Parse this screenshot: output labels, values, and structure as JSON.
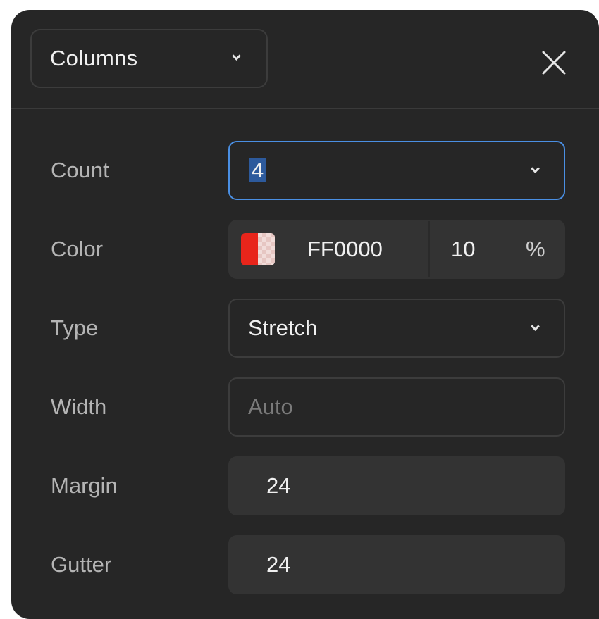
{
  "header": {
    "type_select_label": "Columns"
  },
  "rows": {
    "count": {
      "label": "Count",
      "value": "4"
    },
    "color": {
      "label": "Color",
      "hex": "FF0000",
      "opacity": "10",
      "opacity_unit": "%",
      "swatch_color": "#e8251b"
    },
    "type": {
      "label": "Type",
      "value": "Stretch"
    },
    "width": {
      "label": "Width",
      "placeholder": "Auto"
    },
    "margin": {
      "label": "Margin",
      "value": "24"
    },
    "gutter": {
      "label": "Gutter",
      "value": "24"
    }
  },
  "colors": {
    "panel_bg": "#262626",
    "focus_border": "#4a8fe3",
    "label_text": "#b4b4b4",
    "value_text": "#f0f0f0"
  }
}
